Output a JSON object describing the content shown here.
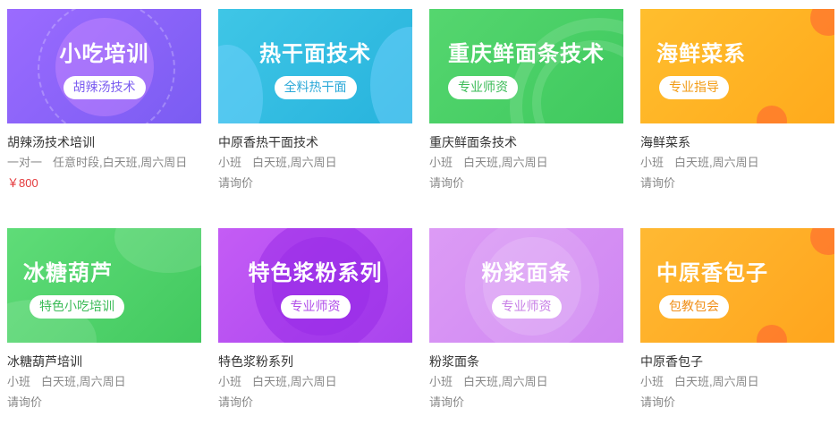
{
  "courses": [
    {
      "banner_title": "小吃培训",
      "banner_tag": "胡辣汤技术",
      "name": "胡辣汤技术培训",
      "type": "一对一",
      "schedule": "任意时段,白天班,周六周日",
      "price": "￥800",
      "theme": {
        "bg": "linear-gradient(135deg,#9b6bff 0%,#7a5cf2 100%)",
        "tag_color": "#7b5cf0",
        "price_color": "#e4393c",
        "ring": "rgba(255,255,255,0.25)"
      }
    },
    {
      "banner_title": "热干面技术",
      "banner_tag": "全料热干面",
      "name": "中原香热干面技术",
      "type": "小班",
      "schedule": "白天班,周六周日",
      "price": "请询价",
      "theme": {
        "bg": "linear-gradient(135deg,#3fc6e6 0%,#27b3dd 100%)",
        "tag_color": "#2aa8d8",
        "price_color": "#888888",
        "ring": "rgba(120,200,255,0.45)"
      }
    },
    {
      "banner_title": "重庆鲜面条技术",
      "banner_tag": "专业师资",
      "name": "重庆鲜面条技术",
      "type": "小班",
      "schedule": "白天班,周六周日",
      "price": "请询价",
      "theme": {
        "bg": "linear-gradient(135deg,#55d66f 0%,#3fc95e 100%)",
        "tag_color": "#3bbb57",
        "price_color": "#888888",
        "ring": "rgba(255,255,255,0.18)"
      }
    },
    {
      "banner_title": "海鲜菜系",
      "banner_tag": "专业指导",
      "name": "海鲜菜系",
      "type": "小班",
      "schedule": "白天班,周六周日",
      "price": "请询价",
      "theme": {
        "bg": "linear-gradient(135deg,#ffbe2e 0%,#ffaa1c 100%)",
        "tag_color": "#f29a12",
        "price_color": "#888888",
        "ring": "rgba(255,110,60,0.55)"
      }
    },
    {
      "banner_title": "冰糖葫芦",
      "banner_tag": "特色小吃培训",
      "name": "冰糖葫芦培训",
      "type": "小班",
      "schedule": "白天班,周六周日",
      "price": "请询价",
      "theme": {
        "bg": "linear-gradient(135deg,#5fdc78 0%,#42c95f 100%)",
        "tag_color": "#3bbb57",
        "price_color": "#888888",
        "ring": "rgba(255,255,255,0.18)"
      }
    },
    {
      "banner_title": "特色浆粉系列",
      "banner_tag": "专业师资",
      "name": "特色浆粉系列",
      "type": "小班",
      "schedule": "白天班,周六周日",
      "price": "请询价",
      "theme": {
        "bg": "linear-gradient(135deg,#c45cf5 0%,#a944ee 100%)",
        "tag_color": "#b04de9",
        "price_color": "#888888",
        "ring": "rgba(150,40,230,0.55)"
      }
    },
    {
      "banner_title": "粉浆面条",
      "banner_tag": "专业师资",
      "name": "粉浆面条",
      "type": "小班",
      "schedule": "白天班,周六周日",
      "price": "请询价",
      "theme": {
        "bg": "linear-gradient(135deg,#dc9bf5 0%,#cf86f2 100%)",
        "tag_color": "#c77ee6",
        "price_color": "#888888",
        "ring": "rgba(255,255,255,0.22)"
      }
    },
    {
      "banner_title": "中原香包子",
      "banner_tag": "包教包会",
      "name": "中原香包子",
      "type": "小班",
      "schedule": "白天班,周六周日",
      "price": "请询价",
      "theme": {
        "bg": "linear-gradient(135deg,#ffb933 0%,#ffa51d 100%)",
        "tag_color": "#f0901b",
        "price_color": "#888888",
        "ring": "rgba(255,110,60,0.55)"
      }
    }
  ]
}
